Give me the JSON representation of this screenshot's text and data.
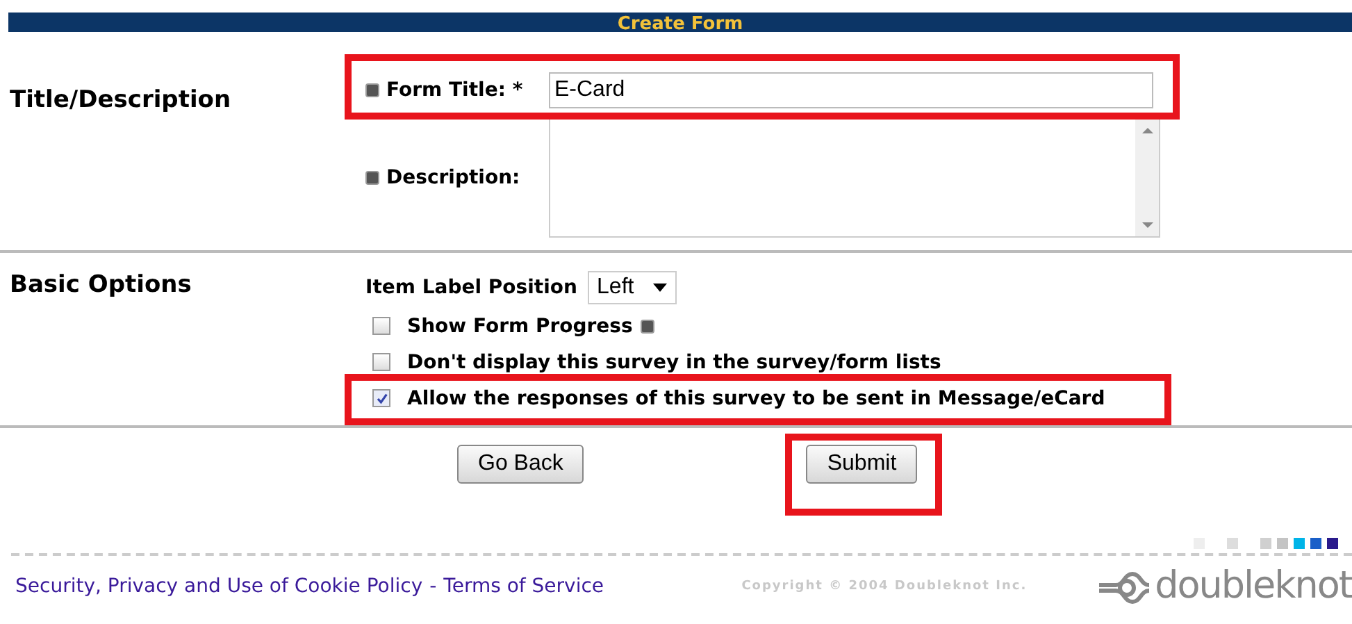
{
  "header": {
    "title": "Create Form"
  },
  "title_section": {
    "heading": "Title/Description",
    "form_title": {
      "label": "Form Title:",
      "required": "*",
      "value": "E-Card",
      "highlighted": true
    },
    "description": {
      "label": "Description:"
    }
  },
  "basic_options": {
    "heading": "Basic Options",
    "label_position": {
      "label": "Item Label Position",
      "value": "Left"
    },
    "options": [
      {
        "label": "Show Form Progress",
        "checked": false,
        "help": true,
        "highlighted": false
      },
      {
        "label": "Don't display this survey in the survey/form lists",
        "checked": false,
        "help": false,
        "highlighted": false
      },
      {
        "label": "Allow the responses of this survey to be sent in Message/eCard",
        "checked": true,
        "help": false,
        "highlighted": true
      }
    ]
  },
  "buttons": [
    {
      "label": "Go Back",
      "highlighted": false
    },
    {
      "label": "Submit",
      "highlighted": true
    }
  ],
  "footer": {
    "links": [
      {
        "label": "Security, Privacy and Use of Cookie Policy"
      },
      {
        "label": "Terms of Service"
      }
    ],
    "separator": "-",
    "copyright": "Copyright © 2004 Doubleknot Inc.",
    "logo": "doubleknot"
  }
}
